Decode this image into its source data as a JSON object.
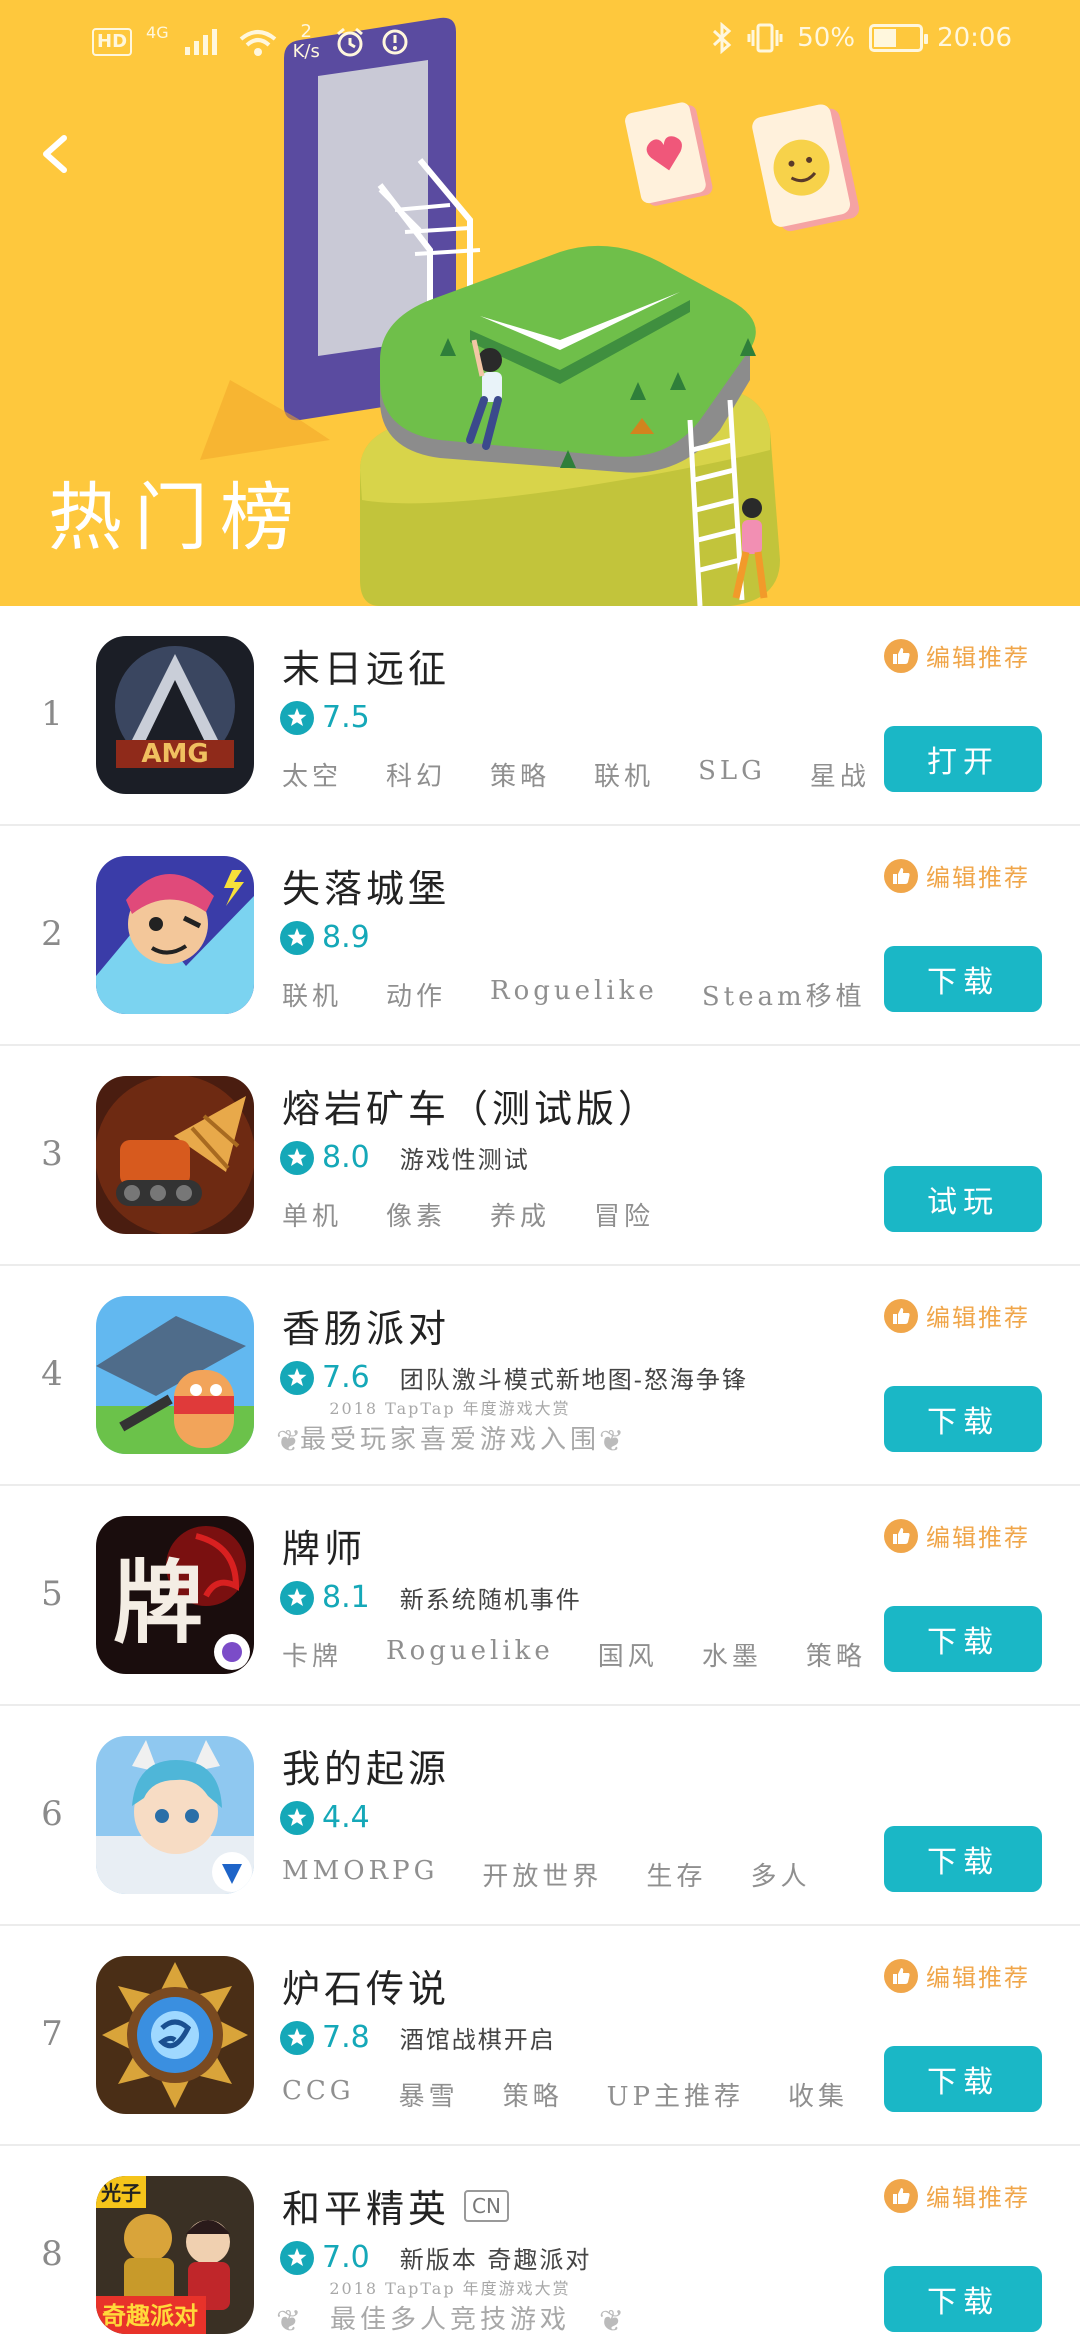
{
  "status_bar": {
    "left": {
      "hd": "HD",
      "network": "4G",
      "speed_value": "2",
      "speed_unit": "K/s"
    },
    "right": {
      "battery_text": "50%",
      "battery_level": 0.5,
      "time": "20:06"
    }
  },
  "header": {
    "title": "热门榜",
    "background": "#fec83d"
  },
  "colors": {
    "accent": "#1ab7c6",
    "star": "#15a8b8",
    "recommend": "#f0a64a"
  },
  "recommend_label": "编辑推荐",
  "apps": [
    {
      "rank": "1",
      "name": "末日远征",
      "score": "7.5",
      "description": "",
      "tags": [
        "太空",
        "科幻",
        "策略",
        "联机",
        "SLG",
        "星战"
      ],
      "award": null,
      "recommended": true,
      "badge": "",
      "button": "打开",
      "icon": "amg-icon"
    },
    {
      "rank": "2",
      "name": "失落城堡",
      "score": "8.9",
      "description": "",
      "tags": [
        "联机",
        "动作",
        "Roguelike",
        "Steam移植"
      ],
      "award": null,
      "recommended": true,
      "badge": "",
      "button": "下载",
      "icon": "lost-castle-icon"
    },
    {
      "rank": "3",
      "name": "熔岩矿车（测试版）",
      "score": "8.0",
      "description": "游戏性测试",
      "tags": [
        "单机",
        "像素",
        "养成",
        "冒险"
      ],
      "award": null,
      "recommended": false,
      "badge": "",
      "button": "试玩",
      "icon": "lava-drill-icon"
    },
    {
      "rank": "4",
      "name": "香肠派对",
      "score": "7.6",
      "description": "团队激斗模式新地图-怒海争锋",
      "tags": [],
      "award": {
        "year": "2018 TapTap 年度游戏大赏",
        "name": "最受玩家喜爱游戏入围"
      },
      "recommended": true,
      "badge": "",
      "button": "下载",
      "icon": "sausage-party-icon"
    },
    {
      "rank": "5",
      "name": "牌师",
      "score": "8.1",
      "description": "新系统随机事件",
      "tags": [
        "卡牌",
        "Roguelike",
        "国风",
        "水墨",
        "策略"
      ],
      "award": null,
      "recommended": true,
      "badge": "",
      "button": "下载",
      "icon": "pai-shi-icon"
    },
    {
      "rank": "6",
      "name": "我的起源",
      "score": "4.4",
      "description": "",
      "tags": [
        "MMORPG",
        "开放世界",
        "生存",
        "多人"
      ],
      "award": null,
      "recommended": false,
      "badge": "",
      "button": "下载",
      "icon": "my-origin-icon"
    },
    {
      "rank": "7",
      "name": "炉石传说",
      "score": "7.8",
      "description": "酒馆战棋开启",
      "tags": [
        "CCG",
        "暴雪",
        "策略",
        "UP主推荐",
        "收集"
      ],
      "award": null,
      "recommended": true,
      "badge": "",
      "button": "下载",
      "icon": "hearthstone-icon"
    },
    {
      "rank": "8",
      "name": "和平精英",
      "score": "7.0",
      "description": "新版本 奇趣派对",
      "tags": [],
      "award": {
        "year": "2018 TapTap 年度游戏大赏",
        "name": "最佳多人竞技游戏"
      },
      "recommended": true,
      "badge": "CN",
      "button": "下载",
      "icon": "peace-elite-icon"
    }
  ]
}
